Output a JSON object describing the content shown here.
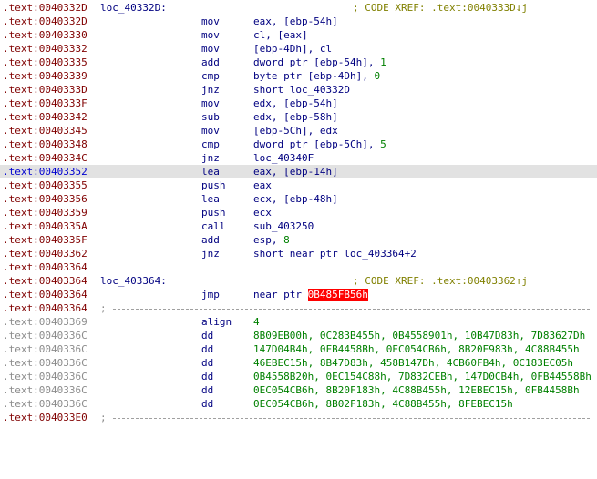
{
  "lines": [
    {
      "seg": ".text:",
      "off": "0040332D",
      "label": "loc_40332D:",
      "xref": "; CODE XREF: .text:0040333D↓j"
    },
    {
      "seg": ".text:",
      "off": "0040332D",
      "mnem": "mov",
      "ops": "eax, [ebp-54h]"
    },
    {
      "seg": ".text:",
      "off": "00403330",
      "mnem": "mov",
      "ops": "cl, [eax]"
    },
    {
      "seg": ".text:",
      "off": "00403332",
      "mnem": "mov",
      "ops": "[ebp-4Dh], cl"
    },
    {
      "seg": ".text:",
      "off": "00403335",
      "mnem": "add",
      "ops_a": "dword ptr [ebp-54h], ",
      "ops_n": "1"
    },
    {
      "seg": ".text:",
      "off": "00403339",
      "mnem": "cmp",
      "ops_a": "byte ptr [ebp-4Dh], ",
      "ops_n": "0"
    },
    {
      "seg": ".text:",
      "off": "0040333D",
      "mnem": "jnz",
      "ops": "short loc_40332D"
    },
    {
      "seg": ".text:",
      "off": "0040333F",
      "mnem": "mov",
      "ops": "edx, [ebp-54h]"
    },
    {
      "seg": ".text:",
      "off": "00403342",
      "mnem": "sub",
      "ops": "edx, [ebp-58h]"
    },
    {
      "seg": ".text:",
      "off": "00403345",
      "mnem": "mov",
      "ops": "[ebp-5Ch], edx"
    },
    {
      "seg": ".text:",
      "off": "00403348",
      "mnem": "cmp",
      "ops_a": "dword ptr [ebp-5Ch], ",
      "ops_n": "5"
    },
    {
      "seg": ".text:",
      "off": "0040334C",
      "mnem": "jnz",
      "ops": "loc_40340F"
    },
    {
      "seg": ".text:",
      "off": "00403352",
      "mnem": "lea",
      "ops": "eax, [ebp-14h]"
    },
    {
      "seg": ".text:",
      "off": "00403355",
      "mnem": "push",
      "ops": "eax"
    },
    {
      "seg": ".text:",
      "off": "00403356",
      "mnem": "lea",
      "ops": "ecx, [ebp-48h]"
    },
    {
      "seg": ".text:",
      "off": "00403359",
      "mnem": "push",
      "ops": "ecx"
    },
    {
      "seg": ".text:",
      "off": "0040335A",
      "mnem": "call",
      "ops": "sub_403250"
    },
    {
      "seg": ".text:",
      "off": "0040335F",
      "mnem": "add",
      "ops_a": "esp, ",
      "ops_n": "8"
    },
    {
      "seg": ".text:",
      "off": "00403362",
      "mnem": "jnz",
      "ops": "short near ptr loc_403364+2"
    },
    {
      "seg": ".text:",
      "off": "00403364"
    },
    {
      "seg": ".text:",
      "off": "00403364",
      "label": "loc_403364:",
      "xref": "; CODE XREF: .text:00403362↑j"
    },
    {
      "seg": ".text:",
      "off": "00403364",
      "mnem": "jmp",
      "ops_a": "near ptr ",
      "ops_bad": "0B485FB56h"
    },
    {
      "seg": ".text:",
      "off": "00403364",
      "sep": ";"
    },
    {
      "seg": ".text:",
      "off": "00403369",
      "mnem": "align",
      "ops_n": "4"
    },
    {
      "seg": ".text:",
      "off": "0040336C",
      "mnem": "dd",
      "ops_n": "8B09EB00h, 0C283B455h, 0B4558901h, 10B47D83h, 7D83627Dh"
    },
    {
      "seg": ".text:",
      "off": "0040336C",
      "mnem": "dd",
      "ops_n": "147D04B4h, 0FB4458Bh, 0EC054CB6h, 8B20E983h, 4C88B455h"
    },
    {
      "seg": ".text:",
      "off": "0040336C",
      "mnem": "dd",
      "ops_n": "46EBEC15h, 8B47D83h, 458B147Dh, 4CB60FB4h, 0C183EC05h"
    },
    {
      "seg": ".text:",
      "off": "0040336C",
      "mnem": "dd",
      "ops_n": "0B4558B20h, 0EC154C88h, 7D832CEBh, 147D0CB4h, 0FB44558Bh"
    },
    {
      "seg": ".text:",
      "off": "0040336C",
      "mnem": "dd",
      "ops_n": "0EC054CB6h, 8B20F183h, 4C88B455h, 12EBEC15h, 0FB4458Bh"
    },
    {
      "seg": ".text:",
      "off": "0040336C",
      "mnem": "dd",
      "ops_n": "0EC054CB6h, 8B02F183h, 4C88B455h, 8FEBEC15h"
    },
    {
      "seg": ".text:",
      "off": "004033E0",
      "sep": ";"
    }
  ]
}
